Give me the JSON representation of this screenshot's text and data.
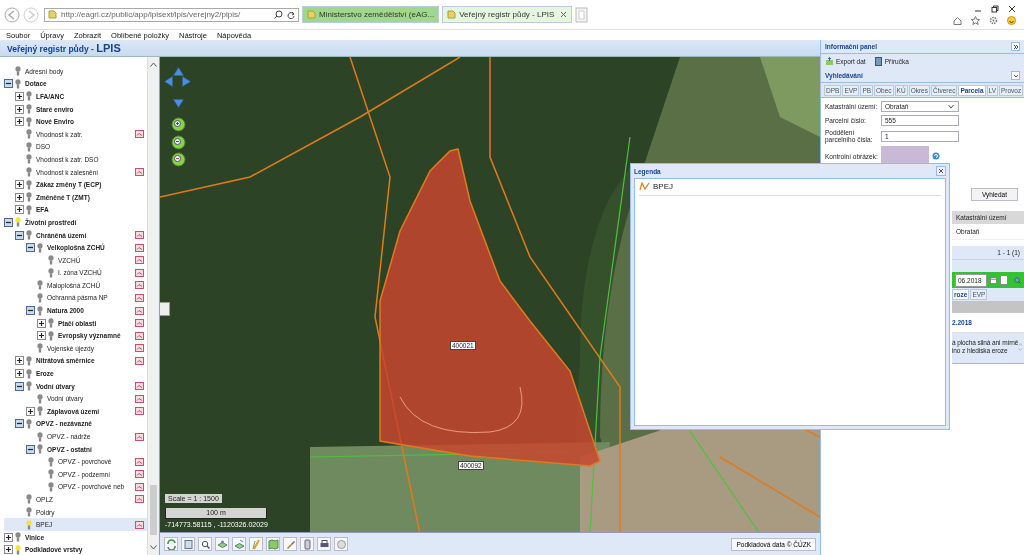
{
  "browser": {
    "address": "http://eagri.cz/public/app/lpisext/lpis/verejny2/plpis/",
    "tabs": [
      {
        "label": "Ministerstvo zemědělství (eAG...",
        "selected": false
      },
      {
        "label": "Veřejný registr půdy - LPIS",
        "selected": true
      }
    ]
  },
  "menu": [
    "Soubor",
    "Úpravy",
    "Zobrazit",
    "Oblíbené položky",
    "Nástroje",
    "Nápověda"
  ],
  "app_title": "Veřejný registr půdy - **LPIS**",
  "tree": {
    "items": [
      {
        "label": "Adresní body",
        "kind": "layer",
        "visible": false,
        "legend": false,
        "selected": false
      },
      {
        "label": "Dotace",
        "kind": "group",
        "expanded": true,
        "visible": false,
        "legend": false,
        "selected": false,
        "children": [
          {
            "label": "LFA/ANC",
            "kind": "group",
            "expanded": false,
            "visible": false,
            "legend": false,
            "selected": false
          },
          {
            "label": "Staré enviro",
            "kind": "group",
            "expanded": false,
            "visible": false,
            "legend": false,
            "selected": false
          },
          {
            "label": "Nové Enviro",
            "kind": "group",
            "expanded": false,
            "visible": false,
            "legend": false,
            "selected": false
          },
          {
            "label": "Vhodnost k zatr.",
            "kind": "layer",
            "visible": false,
            "legend": true,
            "selected": false
          },
          {
            "label": "DSO",
            "kind": "layer",
            "visible": false,
            "legend": false,
            "selected": false
          },
          {
            "label": "Vhodnost k zatr. DSO",
            "kind": "layer",
            "visible": false,
            "legend": false,
            "selected": false
          },
          {
            "label": "Vhodnost k zalesnění",
            "kind": "layer",
            "visible": false,
            "legend": true,
            "selected": false
          },
          {
            "label": "Zákaz změny T (ECP)",
            "kind": "group",
            "expanded": false,
            "visible": false,
            "legend": false,
            "selected": false
          },
          {
            "label": "Změněné T (ZMT)",
            "kind": "group",
            "expanded": false,
            "visible": false,
            "legend": false,
            "selected": false
          },
          {
            "label": "EFA",
            "kind": "group",
            "expanded": false,
            "visible": false,
            "legend": false,
            "selected": false
          }
        ]
      },
      {
        "label": "Životní prostředí",
        "kind": "group",
        "expanded": true,
        "visible": true,
        "legend": false,
        "selected": false,
        "children": [
          {
            "label": "Chráněná území",
            "kind": "group",
            "expanded": true,
            "visible": false,
            "legend": true,
            "selected": false,
            "children": [
              {
                "label": "Velkoplošná ZCHÚ",
                "kind": "group",
                "expanded": true,
                "visible": false,
                "legend": true,
                "selected": false,
                "children": [
                  {
                    "label": "VZCHÚ",
                    "kind": "layer",
                    "visible": false,
                    "legend": true,
                    "selected": false
                  },
                  {
                    "label": "I. zóna VZCHÚ",
                    "kind": "layer",
                    "visible": false,
                    "legend": true,
                    "selected": false
                  }
                ]
              },
              {
                "label": "Maloplošná ZCHÚ",
                "kind": "layer",
                "visible": false,
                "legend": true,
                "selected": false
              },
              {
                "label": "Ochranná pásma NP",
                "kind": "layer",
                "visible": false,
                "legend": true,
                "selected": false
              },
              {
                "label": "Natura 2000",
                "kind": "group",
                "expanded": true,
                "visible": false,
                "legend": true,
                "selected": false,
                "children": [
                  {
                    "label": "Ptačí oblasti",
                    "kind": "group",
                    "expanded": false,
                    "visible": false,
                    "legend": true,
                    "selected": false
                  },
                  {
                    "label": "Evropsky významné",
                    "kind": "group",
                    "expanded": false,
                    "visible": false,
                    "legend": true,
                    "selected": false
                  }
                ]
              },
              {
                "label": "Vojenské újezdy",
                "kind": "layer",
                "visible": false,
                "legend": true,
                "selected": false
              }
            ]
          },
          {
            "label": "Nitrátová směrnice",
            "kind": "group",
            "expanded": false,
            "visible": false,
            "legend": true,
            "selected": false
          },
          {
            "label": "Eroze",
            "kind": "group",
            "expanded": false,
            "visible": false,
            "legend": false,
            "selected": false
          },
          {
            "label": "Vodní útvary",
            "kind": "group",
            "expanded": true,
            "visible": false,
            "legend": true,
            "selected": false,
            "children": [
              {
                "label": "Vodní útvary",
                "kind": "layer",
                "visible": false,
                "legend": true,
                "selected": false
              },
              {
                "label": "Záplavová území",
                "kind": "group",
                "expanded": false,
                "visible": false,
                "legend": true,
                "selected": false
              }
            ]
          },
          {
            "label": "OPVZ - nezávazné",
            "kind": "group",
            "expanded": true,
            "visible": false,
            "legend": false,
            "selected": false,
            "children": [
              {
                "label": "OPVZ - nádrže",
                "kind": "layer",
                "visible": false,
                "legend": true,
                "selected": false
              },
              {
                "label": "OPVZ - ostatní",
                "kind": "group",
                "expanded": true,
                "visible": false,
                "legend": false,
                "selected": false,
                "children": [
                  {
                    "label": "OPVZ - povrchové",
                    "kind": "layer",
                    "visible": false,
                    "legend": true,
                    "selected": false
                  },
                  {
                    "label": "OPVZ - podzemní",
                    "kind": "layer",
                    "visible": false,
                    "legend": true,
                    "selected": false
                  },
                  {
                    "label": "OPVZ - povrchové neb",
                    "kind": "layer",
                    "visible": false,
                    "legend": true,
                    "selected": false
                  }
                ]
              }
            ]
          },
          {
            "label": "OPLZ",
            "kind": "layer",
            "visible": false,
            "legend": true,
            "selected": false
          },
          {
            "label": "Poldry",
            "kind": "layer",
            "visible": false,
            "legend": false,
            "selected": false
          },
          {
            "label": "BPEJ",
            "kind": "layer",
            "visible": true,
            "legend": true,
            "selected": true
          }
        ]
      },
      {
        "label": "Vinice",
        "kind": "group",
        "expanded": false,
        "visible": false,
        "legend": false,
        "selected": false
      },
      {
        "label": "Podkladové vrstvy",
        "kind": "group",
        "expanded": false,
        "visible": true,
        "legend": false,
        "selected": false
      }
    ]
  },
  "map": {
    "parcel_labels": [
      "400021",
      "400092"
    ],
    "scale": "Scale = 1 : 1500",
    "scale_bar": "100 m",
    "coordinates": "-714773.58115 , -1120326.02029",
    "credit": "Podkladová data © ČÚZK"
  },
  "legend": {
    "title": "Legenda",
    "items": [
      "BPEJ"
    ]
  },
  "info_panel": {
    "title": "Informační panel",
    "actions": [
      "Export dat",
      "Příručka"
    ],
    "search_title": "Vyhledávání",
    "tabs": [
      {
        "label": "DPB",
        "selected": false
      },
      {
        "label": "EVP",
        "selected": false
      },
      {
        "label": "PB",
        "selected": false
      },
      {
        "label": "Obec",
        "selected": false
      },
      {
        "label": "KÚ",
        "selected": false
      },
      {
        "label": "Okres",
        "selected": false
      },
      {
        "label": "Čtverec",
        "selected": false
      },
      {
        "label": "Parcela",
        "selected": true
      },
      {
        "label": "LV",
        "selected": false
      },
      {
        "label": "Provoz",
        "selected": false
      }
    ],
    "fields": [
      {
        "kind": "select",
        "label": "Katastrální území:",
        "value": "Obrataň"
      },
      {
        "kind": "text",
        "label": "Parcelní číslo:",
        "value": "555"
      },
      {
        "kind": "text",
        "label": "Poddělení parcelního čísla:",
        "value": "1"
      },
      {
        "kind": "captcha",
        "label": "Kontrolní obrázek:"
      }
    ],
    "search_button": "Vyhledat",
    "results": {
      "column": "Katastrální území",
      "rows": [
        "Obrataň"
      ],
      "pager": "1 - 1 (1)"
    },
    "date": "06.2018",
    "filter_checked": false,
    "lower_tabs": [
      {
        "label": "roze",
        "selected": true
      },
      {
        "label": "EVP",
        "selected": false
      }
    ],
    "record_date": "2.2018",
    "record_lines": [
      "á plocha silná ani mírně",
      "ino z hlediska eroze"
    ]
  }
}
